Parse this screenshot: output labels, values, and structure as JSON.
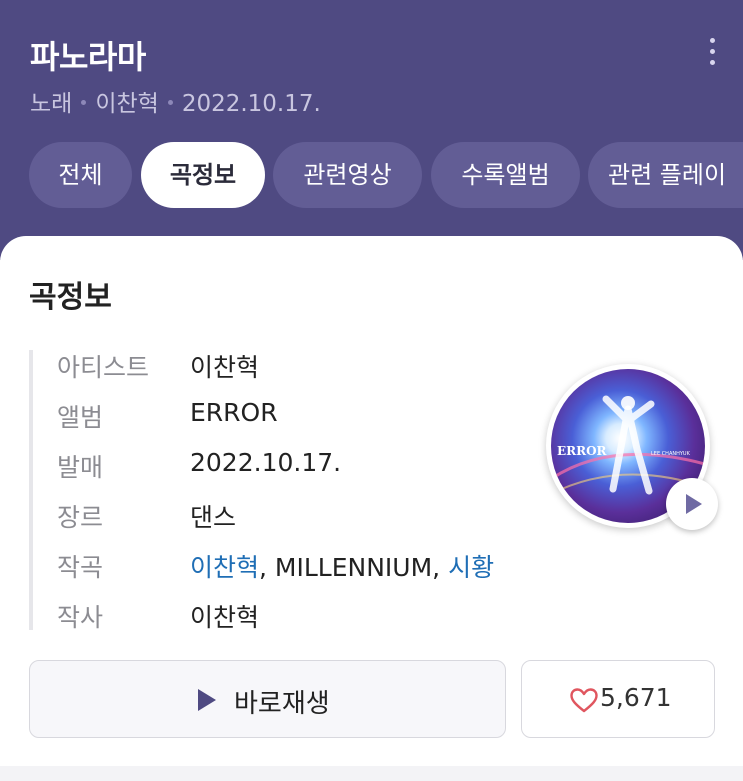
{
  "song": {
    "title": "파노라마",
    "type": "노래",
    "artist": "이찬혁",
    "date": "2022.10.17."
  },
  "tabs": [
    "전체",
    "곡정보",
    "관련영상",
    "수록앨범",
    "관련 플레이"
  ],
  "active_tab": "곡정보",
  "section_title": "곡정보",
  "info": {
    "artist_label": "아티스트",
    "artist_value": "이찬혁",
    "album_label": "앨범",
    "album_value": "ERROR",
    "release_label": "발매",
    "release_value": "2022.10.17.",
    "genre_label": "장르",
    "genre_value": "댄스",
    "composer_label": "작곡",
    "composer_1": "이찬혁",
    "composer_sep1": ", ",
    "composer_2": "MILLENNIUM",
    "composer_sep2": ", ",
    "composer_3": "시황",
    "lyricist_label": "작사",
    "lyricist_value": "이찬혁"
  },
  "album_cover": {
    "title_text": "ERROR",
    "artist_text": "LEE CHANHYUK"
  },
  "actions": {
    "play_label": "바로재생",
    "like_count": "5,671"
  },
  "colors": {
    "header_bg": "#4f4a82",
    "link": "#1f6eb5",
    "heart": "#e0565f",
    "play_icon": "#4f4a82"
  },
  "icons": {
    "more": "more-vertical-icon",
    "play": "play-icon",
    "heart": "heart-outline-icon"
  }
}
